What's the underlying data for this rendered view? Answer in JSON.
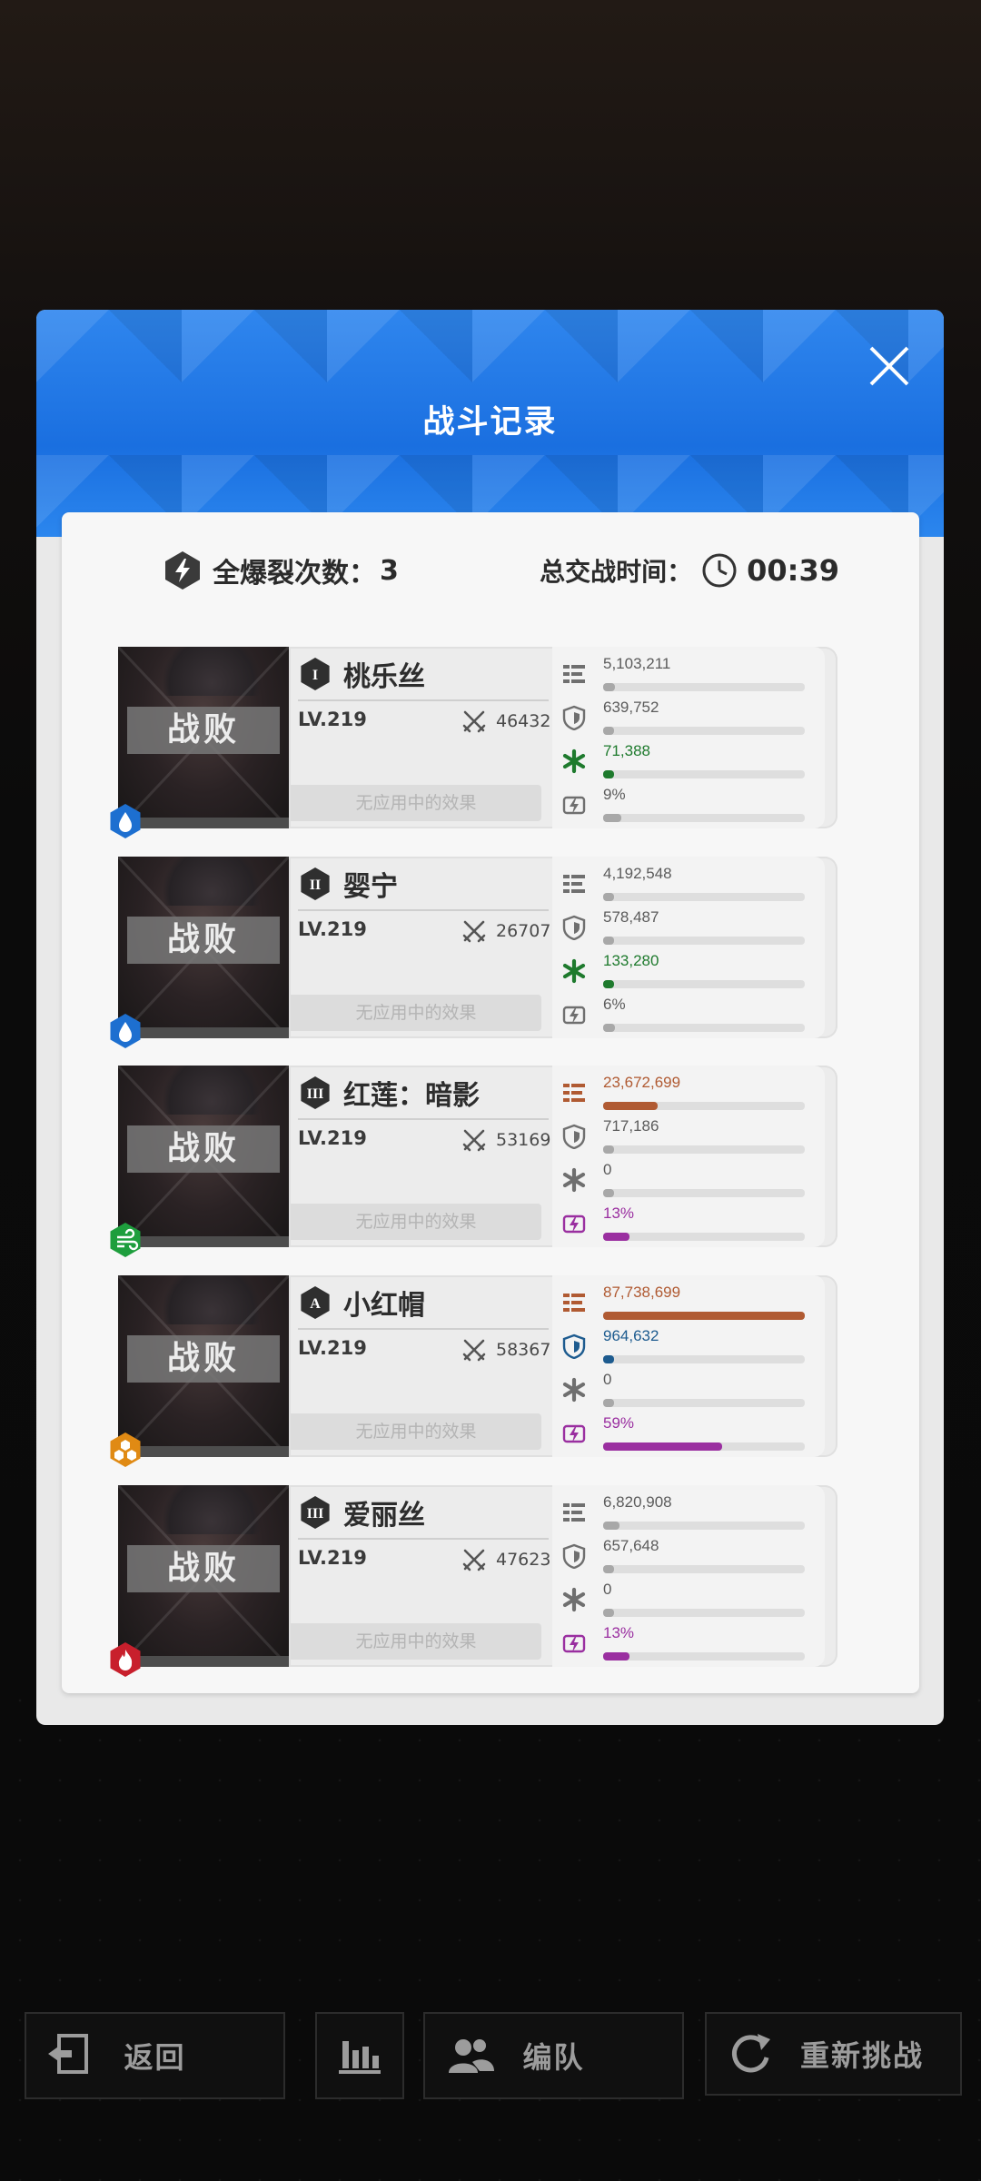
{
  "dialog": {
    "title": "战斗记录"
  },
  "summary": {
    "burst_label": "全爆裂次数：",
    "burst_count": "3",
    "time_label": "总交战时间：",
    "time_value": "00:39"
  },
  "characters": [
    {
      "name": "桃乐丝",
      "rank": "I",
      "level": "LV.219",
      "power": "46432",
      "status": "战败",
      "effects": "无应用中的效果",
      "element": "water",
      "stats": {
        "damage": "5,103,211",
        "damage_ratio": 0.06,
        "shield": "639,752",
        "shield_ratio": 0.0,
        "heal": "71,388",
        "heal_ratio": 0.0,
        "burst": "9%",
        "burst_ratio": 0.09
      }
    },
    {
      "name": "婴宁",
      "rank": "II",
      "level": "LV.219",
      "power": "26707",
      "status": "战败",
      "effects": "无应用中的效果",
      "element": "water",
      "stats": {
        "damage": "4,192,548",
        "damage_ratio": 0.05,
        "shield": "578,487",
        "shield_ratio": 0.0,
        "heal": "133,280",
        "heal_ratio": 0.0,
        "burst": "6%",
        "burst_ratio": 0.06
      }
    },
    {
      "name": "红莲：暗影",
      "rank": "III",
      "level": "LV.219",
      "power": "53169",
      "status": "战败",
      "effects": "无应用中的效果",
      "element": "wind",
      "stats": {
        "damage": "23,672,699",
        "damage_ratio": 0.27,
        "shield": "717,186",
        "shield_ratio": 0.0,
        "heal": "0",
        "heal_ratio": 0.0,
        "burst": "13%",
        "burst_ratio": 0.13
      }
    },
    {
      "name": "小红帽",
      "rank": "A",
      "level": "LV.219",
      "power": "58367",
      "status": "战败",
      "effects": "无应用中的效果",
      "element": "iron",
      "stats": {
        "damage": "87,738,699",
        "damage_ratio": 1.0,
        "shield": "964,632",
        "shield_ratio": 0.01,
        "heal": "0",
        "heal_ratio": 0.0,
        "burst": "59%",
        "burst_ratio": 0.59
      }
    },
    {
      "name": "爱丽丝",
      "rank": "III",
      "level": "LV.219",
      "power": "47623",
      "status": "战败",
      "effects": "无应用中的效果",
      "element": "fire",
      "stats": {
        "damage": "6,820,908",
        "damage_ratio": 0.08,
        "shield": "657,648",
        "shield_ratio": 0.0,
        "heal": "0",
        "heal_ratio": 0.0,
        "burst": "13%",
        "burst_ratio": 0.13
      }
    }
  ],
  "buttons": {
    "back": "返回",
    "stats_icon": "bar-chart-icon",
    "squad": "编队",
    "retry": "重新挑战"
  },
  "colors": {
    "header_blue": "#1f74e6",
    "damage_high": "#b05a32",
    "shield_high": "#1d5b8f",
    "heal_high": "#1e7a2d",
    "burst_high": "#9a2fa0",
    "water": "#1d6fd0",
    "wind": "#1e9e3d",
    "iron": "#e08a14",
    "fire": "#c81f2c"
  }
}
